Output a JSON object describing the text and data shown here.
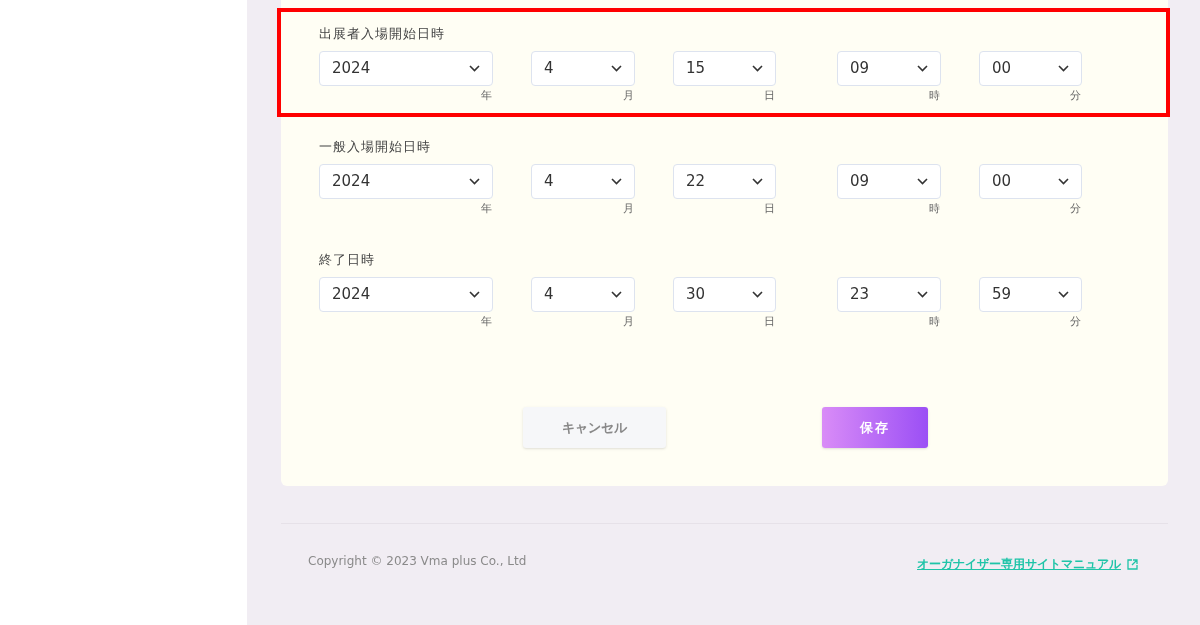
{
  "groups": [
    {
      "label": "出展者入場開始日時",
      "highlighted": true,
      "fields": [
        {
          "value": "2024",
          "unit": "年"
        },
        {
          "value": "4",
          "unit": "月"
        },
        {
          "value": "15",
          "unit": "日"
        },
        {
          "value": "09",
          "unit": "時"
        },
        {
          "value": "00",
          "unit": "分"
        }
      ]
    },
    {
      "label": "一般入場開始日時",
      "highlighted": false,
      "fields": [
        {
          "value": "2024",
          "unit": "年"
        },
        {
          "value": "4",
          "unit": "月"
        },
        {
          "value": "22",
          "unit": "日"
        },
        {
          "value": "09",
          "unit": "時"
        },
        {
          "value": "00",
          "unit": "分"
        }
      ]
    },
    {
      "label": "終了日時",
      "highlighted": false,
      "fields": [
        {
          "value": "2024",
          "unit": "年"
        },
        {
          "value": "4",
          "unit": "月"
        },
        {
          "value": "30",
          "unit": "日"
        },
        {
          "value": "23",
          "unit": "時"
        },
        {
          "value": "59",
          "unit": "分"
        }
      ]
    }
  ],
  "buttons": [
    {
      "label": "キャンセル",
      "kind": "secondary"
    },
    {
      "label": "保存",
      "kind": "primary"
    }
  ],
  "footer": {
    "copyright": "Copyright © 2023 Vma plus Co., Ltd",
    "link": "オーガナイザー専用サイトマニュアル"
  }
}
